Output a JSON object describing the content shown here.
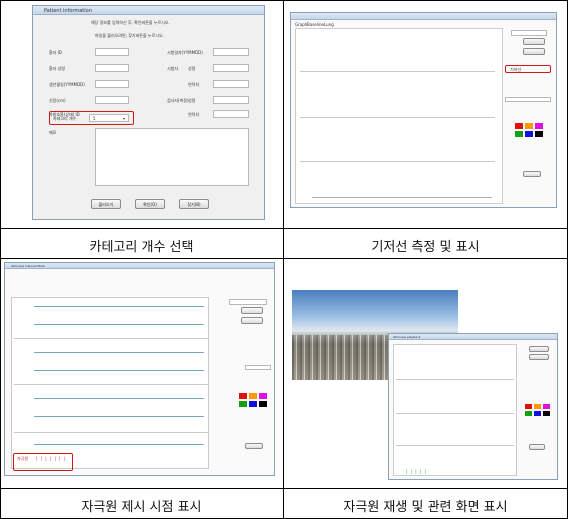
{
  "captions": {
    "top_left": "카테고리 개수 선택",
    "top_right": "기저선 측정 및 표시",
    "bottom_left": "자극원 제시 시점 표시",
    "bottom_right": "자극원 재생 및 관련 화면 표시"
  },
  "patient_form": {
    "title": "Patient information",
    "instruction_1": "해당 정보를 입력하신 후, 확인버튼을 누르시오.",
    "instruction_2": "파일을 불러오려면, 찾기버튼을 누르시오.",
    "labels_left": [
      "환자 ID",
      "환자 성명",
      "생년월일(YYMMDD)",
      "신장(cm)",
      "자발호흡(상태) ID"
    ],
    "labels_right": [
      "시험일자(YYMMDD)",
      "시험자",
      "연락처",
      "검사자(측정)",
      "연락처"
    ],
    "right_sublabels": [
      "성명",
      "성명"
    ],
    "category_label": "카테고리 개수",
    "category_value": "5",
    "memo_label": "메모",
    "buttons": [
      "불러오기",
      "확인(O)",
      "찾기(B)"
    ]
  },
  "baseline_window": {
    "tabs": [
      "Graph",
      "Baseline",
      "Lung"
    ],
    "red_box_text": "기저선"
  },
  "stimulus_window": {
    "title": "Stimulus Interval Mark",
    "red_box_text": "자극원"
  },
  "playback_window": {
    "title": "Stimulus playback"
  },
  "colors": {
    "red_highlight": "#d01818",
    "swatch_red": "#e01010",
    "swatch_orange": "#ff9900",
    "swatch_magenta": "#e010e0",
    "swatch_green": "#10a010",
    "swatch_blue": "#1010e0",
    "swatch_black": "#000000"
  }
}
